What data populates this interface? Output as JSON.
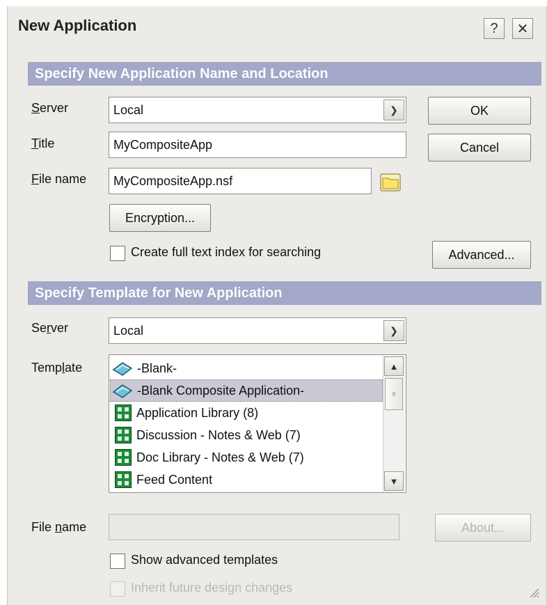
{
  "window": {
    "title": "New Application",
    "help_label": "?",
    "close_label": "✕"
  },
  "section1": {
    "header": "Specify New Application Name and Location",
    "server_label": "Server",
    "server_value": "Local",
    "title_label": "Title",
    "title_value": "MyCompositeApp",
    "filename_label": "File name",
    "filename_value": "MyCompositeApp.nsf",
    "encryption_button": "Encryption...",
    "fulltext_checkbox_label": "Create full text index for searching",
    "fulltext_checked": false
  },
  "buttons": {
    "ok": "OK",
    "cancel": "Cancel",
    "advanced": "Advanced...",
    "about": "About..."
  },
  "section2": {
    "header": "Specify Template for New Application",
    "server_label": "Server",
    "server_value": "Local",
    "template_label": "Template",
    "templates": [
      {
        "label": "-Blank-",
        "icon": "database-icon",
        "selected": false
      },
      {
        "label": "-Blank Composite Application-",
        "icon": "database-icon",
        "selected": true
      },
      {
        "label": "Application Library (8)",
        "icon": "template-icon",
        "selected": false
      },
      {
        "label": "Discussion - Notes & Web (7)",
        "icon": "template-icon",
        "selected": false
      },
      {
        "label": "Doc Library - Notes & Web (7)",
        "icon": "template-icon",
        "selected": false
      },
      {
        "label": "Feed Content",
        "icon": "template-icon",
        "selected": false
      }
    ],
    "filename_label": "File name",
    "filename_value": "",
    "show_advanced_label": "Show advanced templates",
    "show_advanced_checked": false,
    "inherit_label": "Inherit future design changes",
    "inherit_checked": false
  }
}
